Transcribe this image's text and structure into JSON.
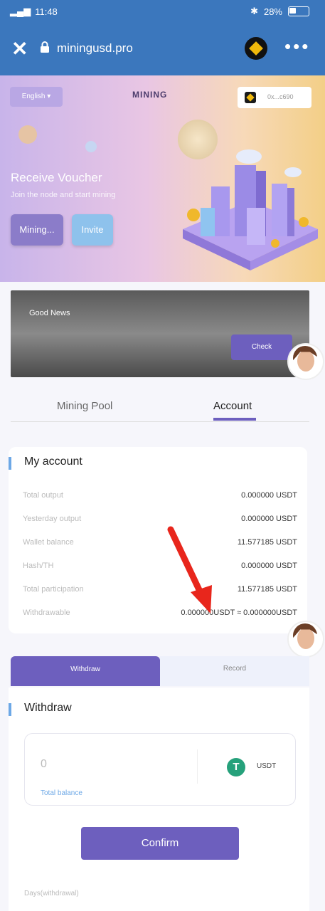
{
  "status_bar": {
    "time": "11:48",
    "battery": "28%"
  },
  "nav": {
    "url": "miningusd.pro",
    "close_icon": "close-icon",
    "more_icon": "more-icon"
  },
  "hero": {
    "language": "English",
    "title": "MINING",
    "account_label": "0x...c690",
    "receive_title": "Receive Voucher",
    "receive_subtitle": "Join the node and start mining",
    "mining_button": "Mining...",
    "invite_button": "Invite"
  },
  "news": {
    "title": "Good News",
    "check_button": "Check"
  },
  "tabs": {
    "pool": "Mining Pool",
    "account": "Account"
  },
  "my_account": {
    "title": "My account",
    "rows": [
      {
        "label": "Total output",
        "value": "0.000000 USDT"
      },
      {
        "label": "Yesterday output",
        "value": "0.000000 USDT"
      },
      {
        "label": "Wallet balance",
        "value": "11.577185 USDT"
      },
      {
        "label": "Hash/TH",
        "value": "0.000000 USDT"
      },
      {
        "label": "Total participation",
        "value": "11.577185 USDT"
      },
      {
        "label": "Withdrawable",
        "value": "0.000000USDT ≈ 0.000000USDT"
      }
    ]
  },
  "segment": {
    "withdraw": "Withdraw",
    "record": "Record"
  },
  "withdraw": {
    "title": "Withdraw",
    "amount": "0",
    "currency": "USDT",
    "total_balance": "Total balance",
    "confirm": "Confirm",
    "days_note": "Days(withdrawal)"
  },
  "colors": {
    "header": "#3b77bd",
    "accent": "#6d5fbe",
    "arrow": "#e8261c"
  }
}
